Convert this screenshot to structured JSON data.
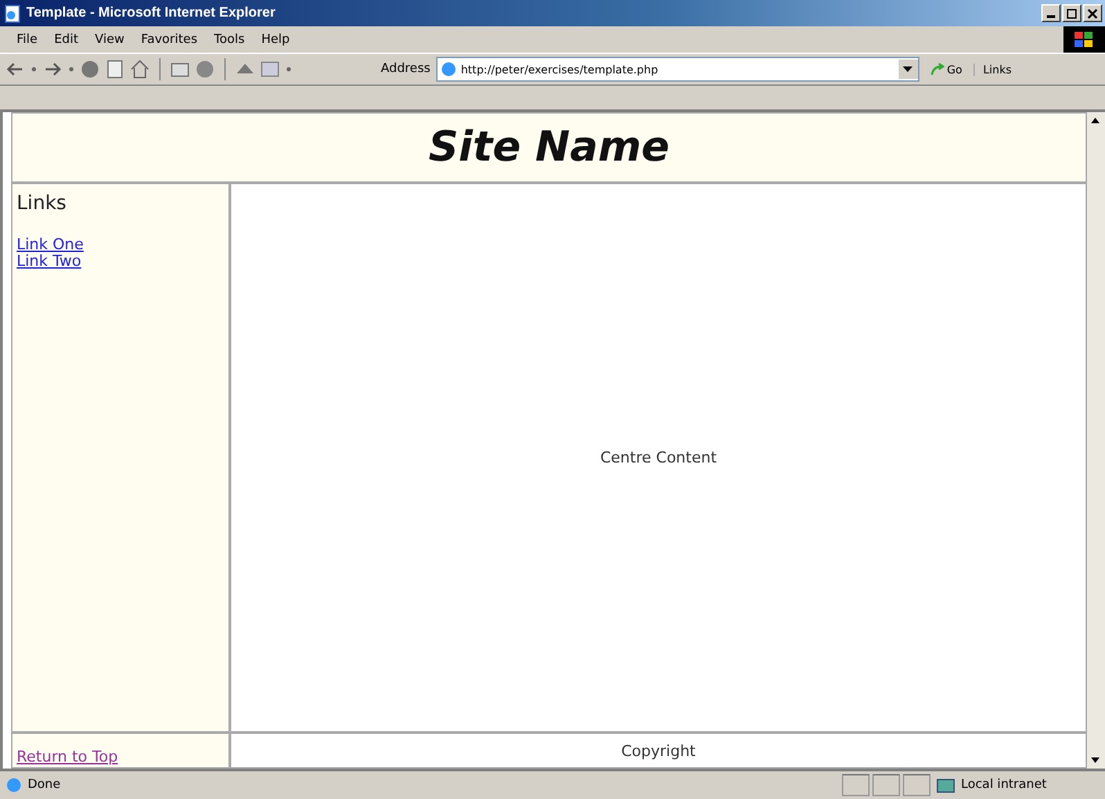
{
  "window": {
    "title": "Template - Microsoft Internet Explorer"
  },
  "menu": [
    "File",
    "Edit",
    "View",
    "Favorites",
    "Tools",
    "Help"
  ],
  "address": {
    "label": "Address",
    "value": "http://peter/exercises/template.php",
    "go": "Go",
    "links": "Links"
  },
  "page": {
    "site_name": "Site Name",
    "sidebar": {
      "heading": "Links",
      "links": [
        {
          "label": "Link One",
          "visited": false
        },
        {
          "label": "Link Two",
          "visited": false
        }
      ]
    },
    "content": "Centre Content",
    "footer": {
      "link": {
        "label": "Return to Top",
        "visited": true
      },
      "text": "Copyright"
    }
  },
  "status_bar": {
    "text": "Done",
    "zone": "Local intranet"
  }
}
